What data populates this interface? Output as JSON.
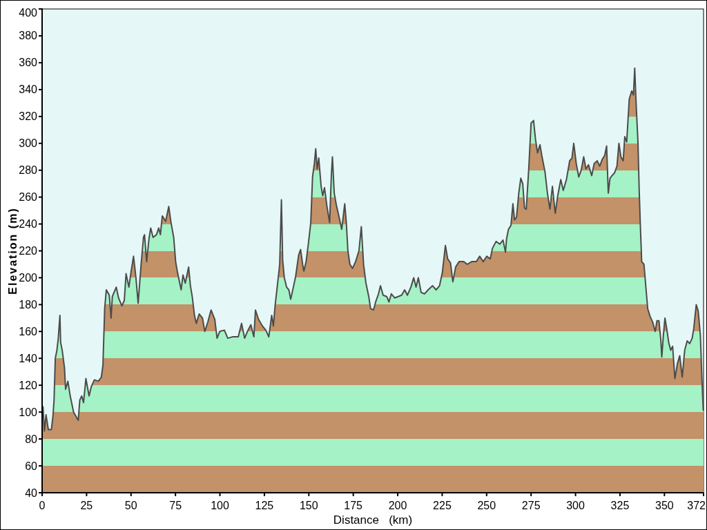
{
  "chart": {
    "chart_data": {
      "type": "area",
      "xlabel": "Distance   (km)",
      "ylabel": "Elevation (m)",
      "xlim": [
        0,
        372
      ],
      "ylim": [
        40,
        400
      ],
      "xticks": [
        0,
        25,
        50,
        75,
        100,
        125,
        150,
        175,
        200,
        225,
        250,
        275,
        300,
        325,
        350,
        372
      ],
      "yticks": [
        40,
        60,
        80,
        100,
        120,
        140,
        160,
        180,
        200,
        220,
        240,
        260,
        280,
        300,
        320,
        340,
        360,
        380,
        400
      ],
      "x": [
        0,
        0.5,
        1.3,
        2.2,
        3.5,
        5.2,
        6.1,
        6.7,
        7.4,
        8.3,
        9.1,
        10.0,
        10.4,
        11.3,
        12.6,
        13.2,
        14.5,
        15.8,
        17.7,
        20.3,
        21.2,
        22.3,
        23.3,
        24.6,
        26.4,
        27.7,
        29.4,
        31.6,
        33.3,
        34.2,
        35.2,
        36.1,
        37.8,
        38.8,
        39.5,
        41.7,
        43.0,
        44.9,
        46.2,
        47.2,
        48.8,
        50.1,
        51.4,
        52.7,
        54.0,
        55.7,
        57.0,
        57.6,
        58.8,
        60.1,
        61.1,
        62.4,
        64.3,
        65.6,
        66.5,
        67.6,
        69.5,
        71.2,
        72.5,
        74.0,
        75.1,
        76.0,
        78.2,
        79.2,
        80.5,
        82.4,
        83.4,
        84.4,
        85.7,
        86.7,
        88.3,
        90.2,
        91.5,
        93.2,
        95.0,
        97.1,
        98.4,
        99.9,
        102.5,
        104.4,
        107.0,
        110.3,
        112.2,
        113.9,
        115.5,
        117.4,
        119.1,
        120.0,
        121.7,
        123.9,
        125.8,
        127.5,
        129.1,
        130.1,
        131.0,
        132.3,
        133.6,
        134.6,
        135.3,
        136.2,
        137.5,
        138.8,
        139.8,
        141.3,
        142.6,
        144.3,
        145.4,
        146.5,
        147.2,
        148.5,
        149.8,
        151.1,
        152.1,
        153.1,
        153.9,
        154.7,
        155.6,
        156.9,
        157.8,
        158.8,
        160.1,
        161.7,
        162.7,
        163.3,
        164.3,
        165.5,
        167.2,
        168.5,
        170.2,
        171.1,
        172.0,
        173.1,
        174.6,
        176.3,
        178.2,
        179.5,
        180.8,
        182.1,
        183.7,
        184.7,
        186.4,
        187.6,
        189.2,
        190.3,
        191.8,
        193.8,
        195.1,
        196.4,
        198.3,
        200.2,
        202.2,
        203.9,
        205.4,
        207.4,
        209.0,
        210.3,
        211.6,
        213.2,
        215.1,
        217.1,
        219.6,
        221.6,
        223.5,
        225.1,
        226.8,
        228.1,
        229.7,
        231.0,
        232.6,
        234.5,
        237.1,
        239.1,
        241.6,
        244.2,
        246.1,
        248.1,
        250.1,
        252.0,
        253.3,
        255.3,
        257.4,
        259.2,
        260.6,
        261.2,
        262.3,
        263.7,
        264.8,
        265.7,
        266.8,
        268.1,
        269.2,
        270.3,
        271.3,
        272.3,
        273.6,
        275.0,
        276.4,
        277.5,
        278.6,
        280.0,
        281.0,
        282.8,
        284.2,
        285.6,
        287.0,
        288.6,
        290.0,
        291.7,
        293.1,
        294.9,
        296.7,
        298.0,
        299.0,
        300.4,
        301.8,
        303.2,
        304.6,
        305.9,
        307.3,
        309.1,
        310.5,
        312.2,
        313.6,
        315.0,
        316.4,
        317.5,
        318.4,
        319.4,
        320.5,
        321.9,
        323.3,
        324.4,
        325.5,
        326.8,
        327.7,
        328.8,
        330.2,
        331.6,
        332.6,
        333.3,
        334.1,
        335.1,
        335.8,
        336.5,
        337.2,
        338.5,
        339.7,
        340.6,
        342.0,
        343.4,
        344.8,
        345.8,
        346.9,
        348.0,
        348.5,
        349.4,
        350.3,
        351.3,
        352.4,
        353.5,
        354.6,
        355.9,
        357.3,
        358.6,
        360.0,
        361.4,
        362.8,
        364.2,
        365.6,
        366.5,
        367.9,
        369.0,
        370.2,
        371.1,
        371.8,
        372
      ],
      "values": [
        98,
        104,
        86,
        98,
        87,
        87,
        97,
        109,
        140,
        146,
        155,
        172,
        152,
        146,
        133,
        117,
        123,
        112,
        100,
        94,
        109,
        112,
        107,
        125,
        112,
        119,
        124,
        123,
        126,
        135,
        177,
        191,
        187,
        170,
        186,
        193,
        185,
        179,
        183,
        203,
        193,
        205,
        216,
        201,
        181,
        210,
        230,
        232,
        212,
        229,
        237,
        230,
        232,
        237,
        232,
        246,
        242,
        253,
        241,
        230,
        212,
        205,
        191,
        202,
        196,
        208,
        194,
        186,
        172,
        166,
        173,
        170,
        160,
        167,
        176,
        169,
        155,
        160,
        161,
        155,
        156,
        156,
        166,
        155,
        160,
        165,
        156,
        176,
        169,
        164,
        161,
        156,
        172,
        164,
        179,
        194,
        210,
        258,
        213,
        200,
        193,
        191,
        184,
        193,
        201,
        217,
        221,
        210,
        205,
        212,
        226,
        241,
        275,
        285,
        296,
        281,
        289,
        268,
        261,
        267,
        254,
        241,
        277,
        290,
        263,
        254,
        244,
        236,
        255,
        241,
        220,
        210,
        207,
        212,
        220,
        238,
        210,
        196,
        186,
        177,
        176,
        182,
        188,
        194,
        187,
        186,
        182,
        188,
        185,
        186,
        187,
        191,
        187,
        193,
        200,
        193,
        200,
        189,
        188,
        191,
        194,
        191,
        194,
        204,
        224,
        214,
        211,
        197,
        208,
        212,
        212,
        210,
        212,
        212,
        216,
        212,
        216,
        214,
        222,
        227,
        225,
        228,
        219,
        229,
        236,
        239,
        255,
        243,
        245,
        263,
        274,
        270,
        252,
        251,
        279,
        315,
        317,
        303,
        293,
        299,
        291,
        279,
        263,
        251,
        268,
        248,
        261,
        273,
        265,
        273,
        287,
        289,
        300,
        285,
        275,
        280,
        290,
        281,
        284,
        276,
        285,
        287,
        283,
        288,
        291,
        298,
        263,
        274,
        276,
        278,
        283,
        300,
        290,
        287,
        305,
        301,
        333,
        339,
        336,
        356,
        329,
        301,
        265,
        237,
        212,
        210,
        191,
        177,
        171,
        167,
        160,
        168,
        168,
        153,
        141,
        157,
        170,
        162,
        152,
        146,
        149,
        125,
        136,
        142,
        126,
        146,
        153,
        151,
        155,
        162,
        180,
        175,
        157,
        124,
        102,
        101
      ]
    }
  }
}
